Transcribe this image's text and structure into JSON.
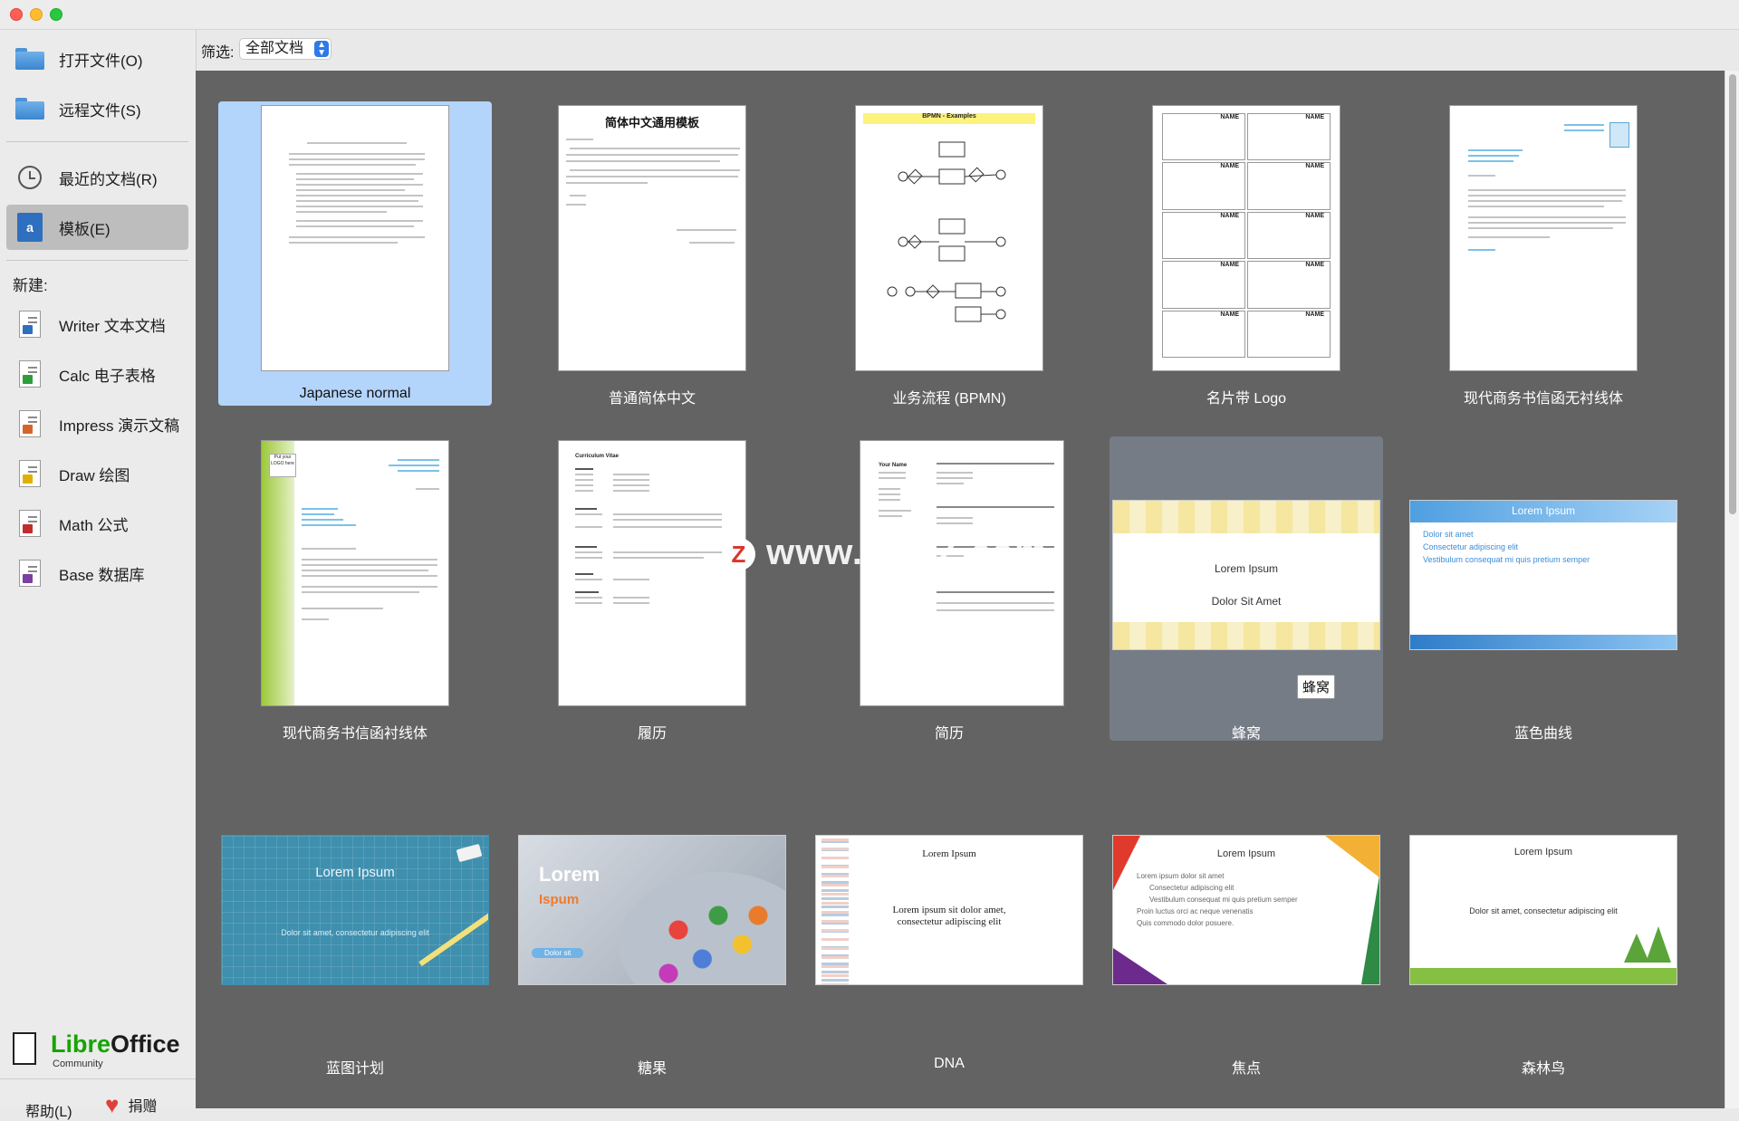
{
  "sidebar": {
    "open_file": "打开文件(O)",
    "remote_file": "远程文件(S)",
    "recent_docs": "最近的文档(R)",
    "templates": "模板(E)",
    "new_heading": "新建:",
    "new_items": [
      {
        "label": "Writer 文本文档",
        "color": "#2f6fbf"
      },
      {
        "label": "Calc 电子表格",
        "color": "#2e9e3c"
      },
      {
        "label": "Impress 演示文稿",
        "color": "#d5642b"
      },
      {
        "label": "Draw 绘图",
        "color": "#e0b000"
      },
      {
        "label": "Math 公式",
        "color": "#c22c2c"
      },
      {
        "label": "Base 数据库",
        "color": "#7a3fa0"
      }
    ],
    "logo_libre": "Libre",
    "logo_office": "Office",
    "logo_sub": "Community",
    "help": "帮助(L)",
    "donate": "捐赠"
  },
  "filter": {
    "label": "筛选:",
    "selected": "全部文档"
  },
  "templates": [
    {
      "caption": "Japanese normal",
      "state": "selected"
    },
    {
      "caption": "普通简体中文"
    },
    {
      "caption": "业务流程 (BPMN)"
    },
    {
      "caption": "名片带 Logo"
    },
    {
      "caption": "现代商务书信函无衬线体"
    },
    {
      "caption": "现代商务书信函衬线体"
    },
    {
      "caption": "履历"
    },
    {
      "caption": "简历"
    },
    {
      "caption": "蜂窝",
      "state": "hover"
    },
    {
      "caption": "蓝色曲线"
    },
    {
      "caption": "蓝图计划"
    },
    {
      "caption": "糖果"
    },
    {
      "caption": "DNA"
    },
    {
      "caption": "焦点"
    },
    {
      "caption": "森林鸟"
    }
  ],
  "thumb_text": {
    "cn_title": "简体中文通用模板",
    "bpmn_title": "BPMN - Examples",
    "name": "NAME",
    "cv_title": "Curriculum Vitae",
    "resume_name": "Your Name",
    "lorem": "Lorem Ipsum",
    "dolor_sit_amet": "Dolor Sit Amet",
    "blue_bullets": [
      "Dolor sit amet",
      "Consectetur adipiscing elit",
      "Vestibulum consequat mi quis pretium semper"
    ],
    "blueprint_sub": "Dolor sit amet, consectetur adipiscing elit",
    "candy_1": "Lorem",
    "candy_2": "Ispum",
    "candy_btn": "Dolor sit",
    "dna_sub": "Lorem ipsum sit dolor amet, consectetur adipiscing elit",
    "focus_bullets": [
      "Lorem ipsum dolor sit amet",
      "Consectetur adipiscing elit",
      "Vestibulum consequat mi quis pretium semper",
      "Proin luctus orci ac neque venenatis",
      "Quis commodo dolor posuere."
    ],
    "forest_sub": "Dolor sit amet, consectetur adipiscing elit",
    "logo_box": "Put your LOGO here"
  },
  "tooltip": "蜂窝",
  "watermark": "www.MacZ.com",
  "watermark_badge": "Z"
}
